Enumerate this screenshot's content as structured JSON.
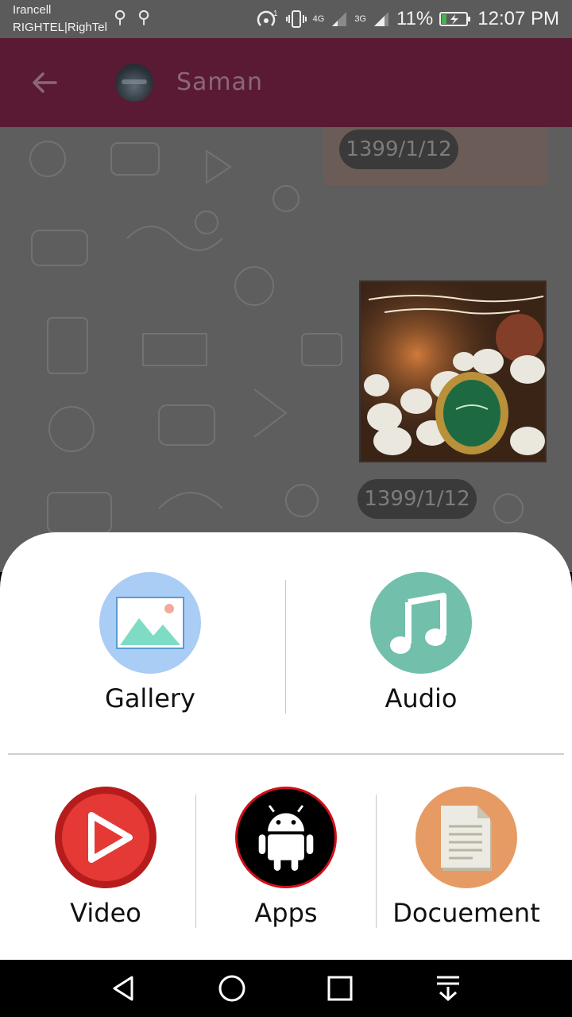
{
  "status_bar": {
    "carrier_primary": "Irancell",
    "carrier_secondary": "RIGHTEL|RighTel",
    "network_1": "4G",
    "network_2": "3G",
    "battery_percent": "11%",
    "time": "12:07 PM",
    "icons": [
      "usb-icon",
      "usb-icon",
      "hotspot-icon",
      "vibrate-icon",
      "signal-icon",
      "signal-icon",
      "battery-charging-icon"
    ]
  },
  "toolbar": {
    "back_icon": "arrow-left-icon",
    "contact_name": "Saman",
    "background_color": "#5a1a33"
  },
  "chat": {
    "messages": [
      {
        "type": "date",
        "text": "1399/1/12"
      },
      {
        "type": "image",
        "caption": ""
      },
      {
        "type": "date",
        "text": "1399/1/12"
      }
    ]
  },
  "attach_sheet": {
    "options": [
      {
        "label": "Gallery",
        "icon": "gallery-icon",
        "color": "#a9cdf5"
      },
      {
        "label": "Audio",
        "icon": "music-note-icon",
        "color": "#72bfac"
      },
      {
        "label": "Video",
        "icon": "play-icon",
        "color": "#d32f2f"
      },
      {
        "label": "Apps",
        "icon": "android-icon",
        "color": "#000000"
      },
      {
        "label": "Docuement",
        "icon": "document-icon",
        "color": "#e59b63"
      }
    ]
  },
  "nav_bar": {
    "buttons": [
      "back-triangle-icon",
      "home-circle-icon",
      "recents-square-icon",
      "notification-pull-icon"
    ]
  }
}
